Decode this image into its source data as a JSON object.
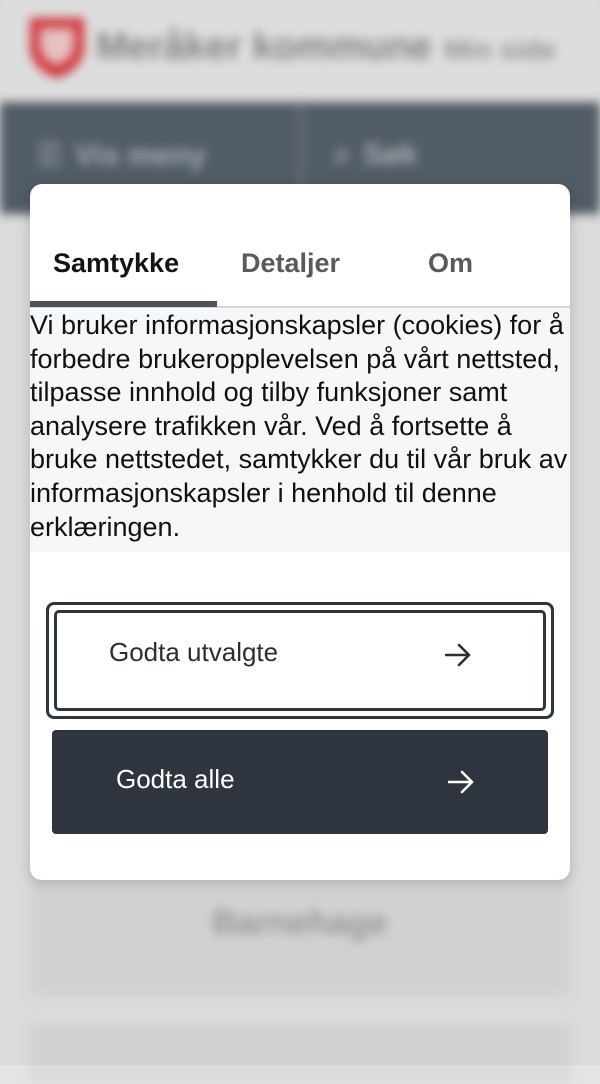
{
  "background": {
    "site_name": "Meråker kommune",
    "site_subtitle": "Min side",
    "nav": {
      "menu_label": "Vis meny",
      "search_label": "Søk"
    },
    "card_label": "Barnehage"
  },
  "dialog": {
    "tabs": [
      {
        "label": "Samtykke",
        "active": true
      },
      {
        "label": "Detaljer",
        "active": false
      },
      {
        "label": "Om",
        "active": false
      }
    ],
    "body_text": "Vi bruker informasjonskapsler (cookies) for å forbedre brukeropplevelsen på vårt nettsted, tilpasse innhold og tilby funksjoner samt analysere trafikken vår. Ved å fortsette å bruke nettstedet, samtykker du til vår bruk av informasjonskapsler i henhold til denne erklæringen.",
    "buttons": {
      "accept_selected": "Godta utvalgte",
      "accept_all": "Godta alle"
    }
  },
  "colors": {
    "accent_dark": "#2f353e",
    "nav_bar": "#56606b",
    "logo_red": "#d9393f"
  },
  "icons": {
    "logo": "municipality-shield-icon",
    "menu": "hamburger-icon",
    "search": "search-icon",
    "arrow": "arrow-right-icon"
  }
}
